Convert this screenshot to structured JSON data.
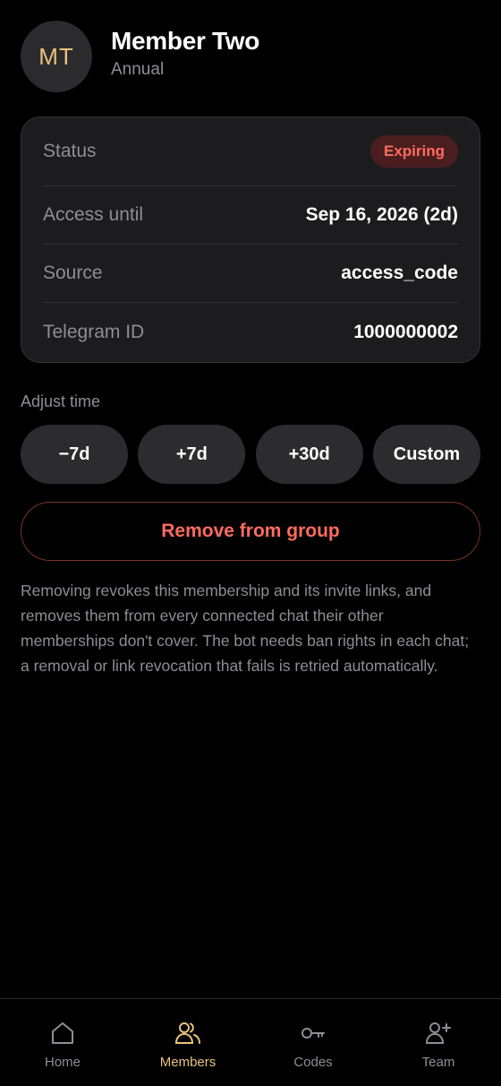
{
  "member": {
    "initials": "MT",
    "name": "Member Two",
    "plan": "Annual"
  },
  "details": {
    "status_label": "Status",
    "status_value": "Expiring",
    "access_label": "Access until",
    "access_value": "Sep 16, 2026 (2d)",
    "source_label": "Source",
    "source_value": "access_code",
    "telegram_label": "Telegram ID",
    "telegram_value": "1000000002"
  },
  "adjust": {
    "label": "Adjust time",
    "buttons": [
      "−7d",
      "+7d",
      "+30d",
      "Custom"
    ]
  },
  "remove": {
    "label": "Remove from group",
    "note": "Removing revokes this membership and its invite links, and removes them from every connected chat their other memberships don't cover. The bot needs ban rights in each chat; a removal or link revocation that fails is retried automatically."
  },
  "nav": {
    "items": [
      {
        "label": "Home",
        "icon": "home-icon",
        "active": false
      },
      {
        "label": "Members",
        "icon": "members-icon",
        "active": true
      },
      {
        "label": "Codes",
        "icon": "key-icon",
        "active": false
      },
      {
        "label": "Team",
        "icon": "add-user-icon",
        "active": false
      }
    ]
  },
  "colors": {
    "accent": "#e8c27a",
    "danger": "#ff6b5e",
    "background": "#000000",
    "card": "#1c1c1e"
  }
}
